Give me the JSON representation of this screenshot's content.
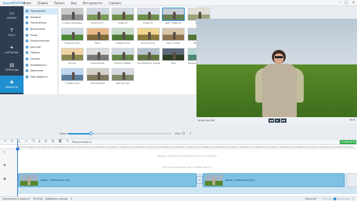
{
  "app": {
    "name": "ВидеоМОНТАЖ"
  },
  "menu": [
    "Файл",
    "Правка",
    "Проект",
    "Вид",
    "Инструменты",
    "Справка"
  ],
  "nav": [
    {
      "label": "ФАЙЛЫ",
      "icon": "folder-icon"
    },
    {
      "label": "ТЕКСТ",
      "icon": "text-icon"
    },
    {
      "label": "КАРТИНКИ",
      "icon": "image-icon"
    },
    {
      "label": "ПЕРЕХОДЫ",
      "icon": "transition-icon"
    },
    {
      "label": "ЭФФЕКТЫ",
      "icon": "effects-icon",
      "active": true
    }
  ],
  "categories": [
    "Популярные",
    "Базовые",
    "Чёрно-белые",
    "Винтажные",
    "Ретро",
    "Романтические",
    "Детские",
    "Пейзаж",
    "Ночные",
    "Калейдоскоп",
    "Движение",
    "Мои эффекты"
  ],
  "effects": [
    "Старые кб фильмы",
    "Фильтр 35 ч.",
    "Кодак 01",
    "Кодак 02",
    "Цвет - Кодак 01",
    "Мягко",
    "Зеленый стиль",
    "Закат",
    "Зелёные тона",
    "Золотые лучи",
    "Кино и сепия",
    "Виньетка",
    "Восход",
    "Чёрно-белый",
    "Портрет эффект",
    "Огни большого города",
    "Ночь",
    "Бирюзовые оттенки",
    "Голубые лучи",
    "Классический",
    "Цветной шум"
  ],
  "scale": {
    "label": "Окно:",
    "value": "22%",
    "level_percent": 22
  },
  "player": {
    "timecode": "00:00:00.000",
    "play_labels": [
      "◀◀",
      "▶",
      "▶▶"
    ],
    "aspect": "16:9"
  },
  "toolbar": {
    "edit_label": "Редактировать",
    "save_label": "СОХРАНИТЬ"
  },
  "ruler": [
    "00:00:00.000",
    "00:00:02.000",
    "00:00:04.000",
    "00:00:06.000",
    "00:00:08.000",
    "00:00:10.000",
    "00:00:12.000",
    "00:00:14.000",
    "00:00:16.000",
    "00:00:18.000",
    "00:00:20.000",
    "00:00:22.000",
    "00:00:24.000",
    "00:00:26.000",
    "00:00:28.000",
    "00:00:30.000",
    "00:00:32.000",
    "00:00:34.000",
    "00:00:36.000",
    "00:00:38.000",
    "00:00:40.000",
    "00:00:42.000",
    "00:00:44.000",
    "00:00:46.000",
    "00:00:48.000"
  ],
  "timeline": {
    "hint_text": "Дважды щелкните для добавления текста и графики",
    "hint_video": "Наложите свое видео и фото поверх другого",
    "clips": [
      "Видео-1-Обрезка-01.mp4",
      "Видео-1-Обрезка-02.mp4"
    ]
  },
  "status": {
    "duration_label": "Длительность проекта:",
    "duration": "00:00:00",
    "clips_label": "Добавлено клипов:",
    "clips": "2",
    "zoom_label": "Масштаб:"
  },
  "colors": {
    "accent": "#1f8fd1",
    "save": "#2eae4f",
    "nav": "#2e3d4f"
  }
}
